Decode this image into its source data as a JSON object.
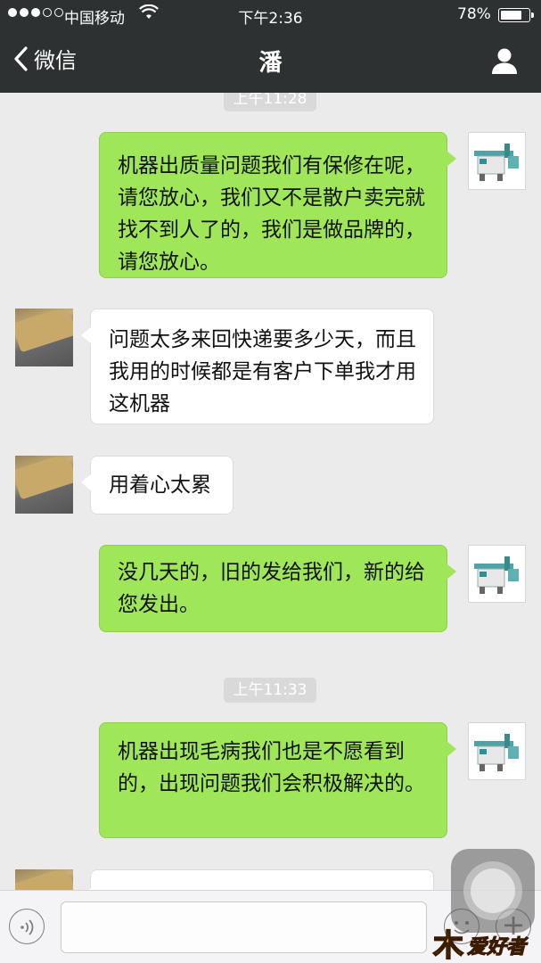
{
  "status_bar": {
    "carrier": "中国移动",
    "time": "下午2:36",
    "battery_percent": "78%",
    "battery_level": 0.78,
    "signal_bars_filled": 3,
    "signal_bars_total": 5
  },
  "nav": {
    "back_label": "微信",
    "title": "潘"
  },
  "timestamps": [
    "上午11:28",
    "上午11:33"
  ],
  "messages": [
    {
      "from": "me",
      "text": "机器出质量问题我们有保修在呢，请您放心，我们又不是散户卖完就找不到人了的，我们是做品牌的，请您放心。"
    },
    {
      "from": "them",
      "text": "问题太多来回快递要多少天，而且我用的时候都是有客户下单我才用这机器"
    },
    {
      "from": "them",
      "text": "用着心太累"
    },
    {
      "from": "me",
      "text": "没几天的，旧的发给我们，新的给您发出。"
    },
    {
      "from": "me",
      "text": "机器出现毛病我们也是不愿看到的，出现问题我们会积极解决的。"
    },
    {
      "from": "them",
      "text": ""
    }
  ],
  "input": {
    "placeholder": ""
  },
  "icons": {
    "back": "chevron-left-icon",
    "profile": "person-icon",
    "voice": "voice-icon",
    "emoji": "emoji-icon",
    "more": "plus-icon"
  },
  "watermark_text": "爱好者",
  "colors": {
    "nav_bg": "#2e3132",
    "chat_bg": "#ebebeb",
    "my_bubble": "#9fe658",
    "their_bubble": "#ffffff",
    "timestamp_bg": "#d9d9d9"
  }
}
